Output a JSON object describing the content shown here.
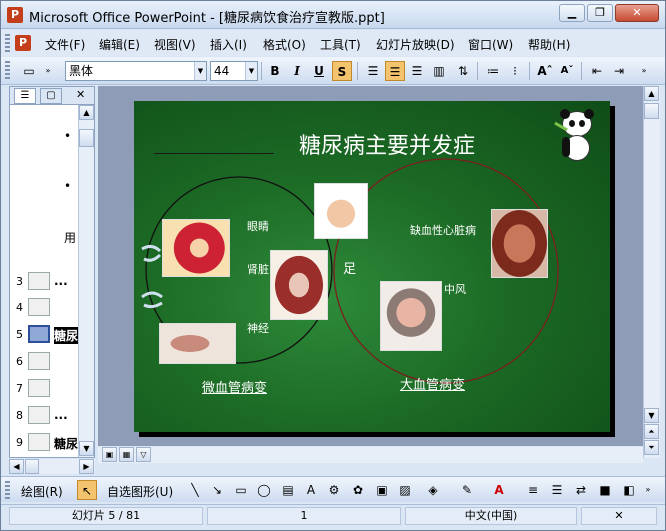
{
  "window": {
    "title": "Microsoft Office PowerPoint - [糖尿病饮食治疗宣教版.ppt]",
    "minimize": "▁",
    "maximize": "❐",
    "close": "✕"
  },
  "menu": [
    "文件(F)",
    "编辑(E)",
    "视图(V)",
    "插入(I)",
    "格式(O)",
    "工具(T)",
    "幻灯片放映(D)",
    "窗口(W)",
    "帮助(H)"
  ],
  "toolbar": {
    "font": "黑体",
    "size": "44",
    "bold": "B",
    "italic": "I",
    "underline": "U",
    "shadow": "S",
    "increase": "Aˆ",
    "decrease": "Aˇ"
  },
  "left_pane": {
    "tab_outline": "☰",
    "tab_slides": "▢",
    "close": "✕",
    "outline_lines": [
      "•",
      "•",
      "用"
    ],
    "thumbnails": [
      {
        "num": "3",
        "text": "..."
      },
      {
        "num": "4",
        "text": ""
      },
      {
        "num": "5",
        "text": "糖尿"
      },
      {
        "num": "6",
        "text": ""
      },
      {
        "num": "7",
        "text": ""
      },
      {
        "num": "8",
        "text": "..."
      },
      {
        "num": "9",
        "text": "糖尿"
      }
    ]
  },
  "slide": {
    "title": "糖尿病主要并发症",
    "eye": "眼睛",
    "kidney": "肾脏",
    "nerve": "神经",
    "foot": "足",
    "heart": "缺血性心脏病",
    "stroke": "中风",
    "micro": "微血管病变",
    "macro": "大血管病变"
  },
  "drawbar": {
    "draw": "绘图(R)",
    "autoshape": "自选图形(U)"
  },
  "status": {
    "slide": "幻灯片 5 / 81",
    "design": "1",
    "lang": "中文(中国)"
  },
  "colors": {
    "slide_bg": "#1c6a25",
    "title": "#ffffff",
    "circle_left": "#111111",
    "circle_right": "#7a1f1f"
  }
}
